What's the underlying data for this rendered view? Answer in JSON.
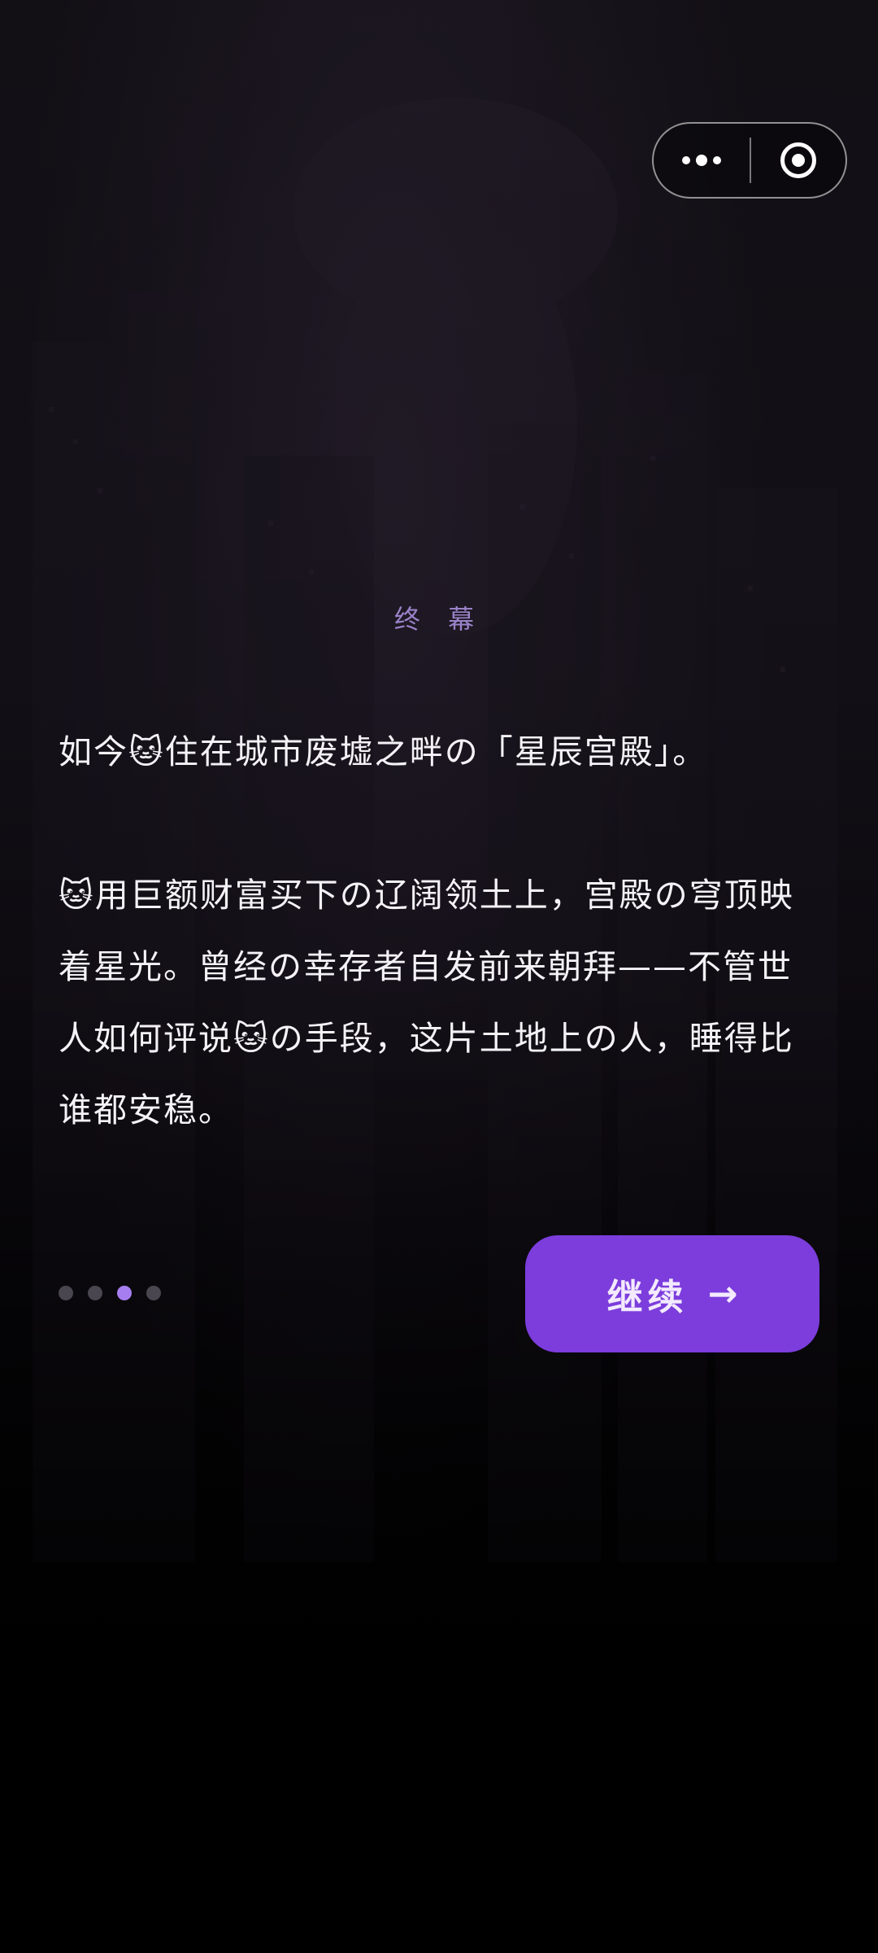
{
  "scene": {
    "chapter_label": "终 幕",
    "paragraphs": [
      "如今🐱住在城市废墟之畔の「星辰宫殿」。",
      "🐱用巨额财富买下の辽阔领土上，宫殿の穹顶映着星光。曾经の幸存者自发前来朝拜——不管世人如何评说🐱の手段，这片土地上の人，睡得比谁都安稳。"
    ]
  },
  "pagination": {
    "total": 4,
    "current": 3
  },
  "actions": {
    "continue_label": "继续",
    "continue_arrow": "→"
  },
  "capsule": {
    "more_icon": "more-dots-icon",
    "close_icon": "target-close-icon"
  },
  "colors": {
    "accent": "#7c3ddc",
    "dot_active": "#a77ef0",
    "dot_inactive": "#4a4650",
    "chapter_label": "#9a82c8"
  }
}
